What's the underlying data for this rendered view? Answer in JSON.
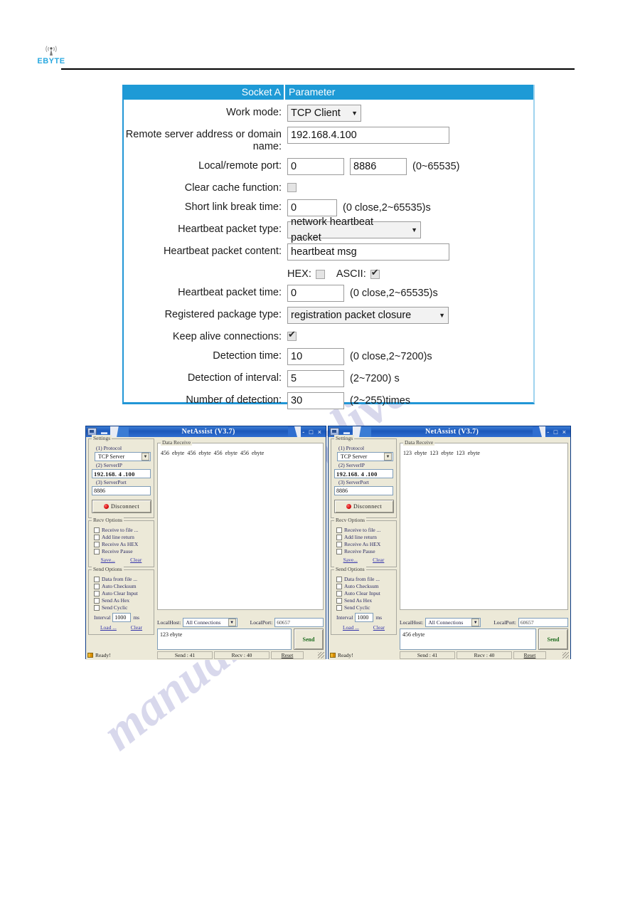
{
  "header": {
    "logo_text": "EBYTE",
    "logo_icon": "antenna-signal-icon"
  },
  "watermark": {
    "line1": "alsplive.com",
    "line2": "manualslib"
  },
  "socket_form": {
    "head_left": "Socket A",
    "head_right": "Parameter",
    "rows": {
      "work_mode": {
        "label": "Work mode:",
        "value": "TCP Client"
      },
      "remote_server": {
        "label": "Remote server address or domain name:",
        "value": "192.168.4.100"
      },
      "local_remote_port": {
        "label": "Local/remote port:",
        "local_value": "0",
        "remote_value": "8886",
        "hint": "(0~65535)"
      },
      "clear_cache": {
        "label": "Clear cache function:",
        "checked": false
      },
      "short_link_break": {
        "label": "Short link break time:",
        "value": "0",
        "hint": "(0 close,2~65535)s"
      },
      "heartbeat_type": {
        "label": "Heartbeat packet type:",
        "value": "network heartbeat packet"
      },
      "heartbeat_content": {
        "label": "Heartbeat packet content:",
        "value": "heartbeat msg"
      },
      "encoding": {
        "hex_label": "HEX:",
        "hex_checked": false,
        "ascii_label": "ASCII:",
        "ascii_checked": true
      },
      "heartbeat_time": {
        "label": "Heartbeat packet time:",
        "value": "0",
        "hint": "(0 close,2~65535)s"
      },
      "registered_type": {
        "label": "Registered package type:",
        "value": "registration packet closure"
      },
      "keep_alive": {
        "label": "Keep alive connections:",
        "checked": true
      },
      "detection_time": {
        "label": "Detection time:",
        "value": "10",
        "hint": "(0 close,2~7200)s"
      },
      "detection_interval": {
        "label": "Detection of interval:",
        "value": "5",
        "hint": "(2~7200) s"
      },
      "detection_number": {
        "label": "Number of detection:",
        "value": "30",
        "hint": "(2~255)times"
      }
    }
  },
  "netassist_common": {
    "title": "NetAssist (V3.7)",
    "min_max_close": "-  □  ×",
    "settings_group": "Settings",
    "protocol_label": "(1) Protocol",
    "protocol_value": "TCP Server",
    "serverip_label": "(2) ServerIP",
    "serverport_label": "(3) ServerPort",
    "disconnect_label": "Disconnect",
    "recv_options_group": "Recv Options",
    "recv_options": [
      "Receive to file ...",
      "Add line return",
      "Receive As HEX",
      "Receive Pause"
    ],
    "recv_links": [
      "Save...",
      "Clear"
    ],
    "send_options_group": "Send Options",
    "send_options": [
      "Data from file ...",
      "Auto Checksum",
      "Auto Clear Input",
      "Send As Hex",
      "Send Cyclic"
    ],
    "interval_label": "Interval",
    "interval_value": "1000",
    "interval_unit": "ms",
    "send_links": [
      "Load ...",
      "Clear"
    ],
    "data_receive_group": "Data Receive",
    "localhost_label": "LocalHost:",
    "localhost_value": "All Connections",
    "localport_label": "LocalPort:",
    "localport_value": "60657",
    "send_button": "Send",
    "status_ready": "Ready!",
    "status_send": "Send : 41",
    "status_recv": "Recv : 40",
    "status_reset": "Reset"
  },
  "netassist_left": {
    "serverip_value": "192.168. 4 .100",
    "serverport_value": "8886",
    "received_text": "456 ebyte 456 ebyte 456 ebyte 456 ebyte",
    "send_text": "123 ebyte"
  },
  "netassist_right": {
    "serverip_value": "192.168. 4 .100",
    "serverport_value": "8886",
    "received_text": "123 ebyte 123 ebyte 123 ebyte",
    "send_text": "456 ebyte"
  }
}
